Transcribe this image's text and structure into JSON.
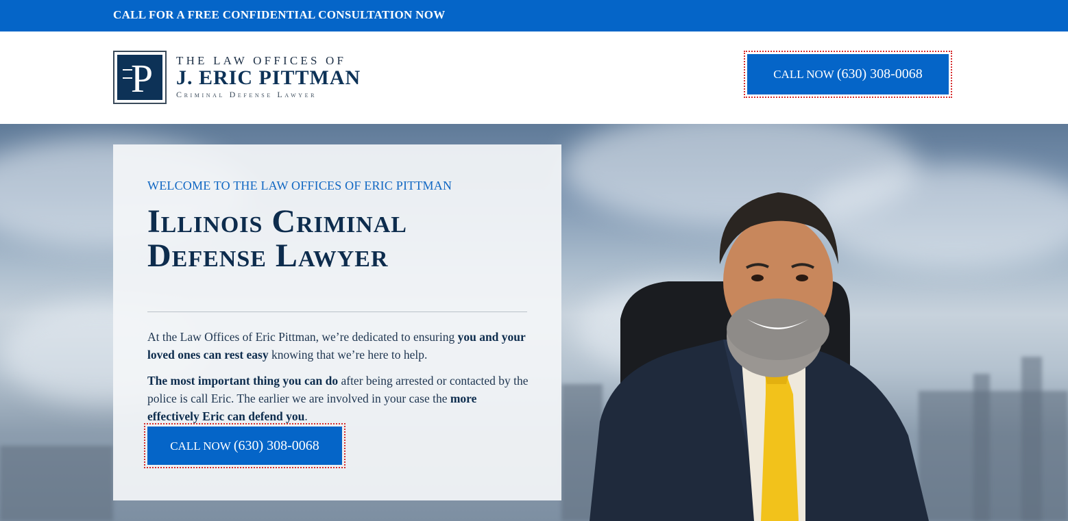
{
  "topbar": {
    "text": "CALL FOR A FREE CONFIDENTIAL CONSULTATION NOW"
  },
  "logo": {
    "monogram": "P",
    "line1": "THE LAW OFFICES OF",
    "line2": "J. ERIC PITTMAN",
    "line3": "Criminal Defense Lawyer"
  },
  "header_cta": {
    "prefix": "CALL NOW",
    "phone": "(630) 308-0068"
  },
  "hero": {
    "eyebrow": "WELCOME TO THE LAW OFFICES OF ERIC PITTMAN",
    "headline_line1": "Illinois Criminal",
    "headline_line2": "Defense Lawyer",
    "para1": {
      "t1": "At the Law Offices of Eric Pittman, we’re dedicated to ensuring ",
      "b1": "you and your loved ones can rest easy",
      "t2": " knowing that we’re here to help."
    },
    "para2": {
      "b1": "The most important thing you can do",
      "t1": " after being arrested or contacted by the police is call Eric. The earlier we are involved in your case the ",
      "b2": "more effectively Eric can defend you",
      "t2": "."
    },
    "cta": {
      "prefix": "CALL NOW",
      "phone": "(630) 308-0068"
    }
  },
  "colors": {
    "brand_blue": "#0565c8",
    "navy": "#0d2c4d",
    "tie_yellow": "#f2c21b"
  }
}
